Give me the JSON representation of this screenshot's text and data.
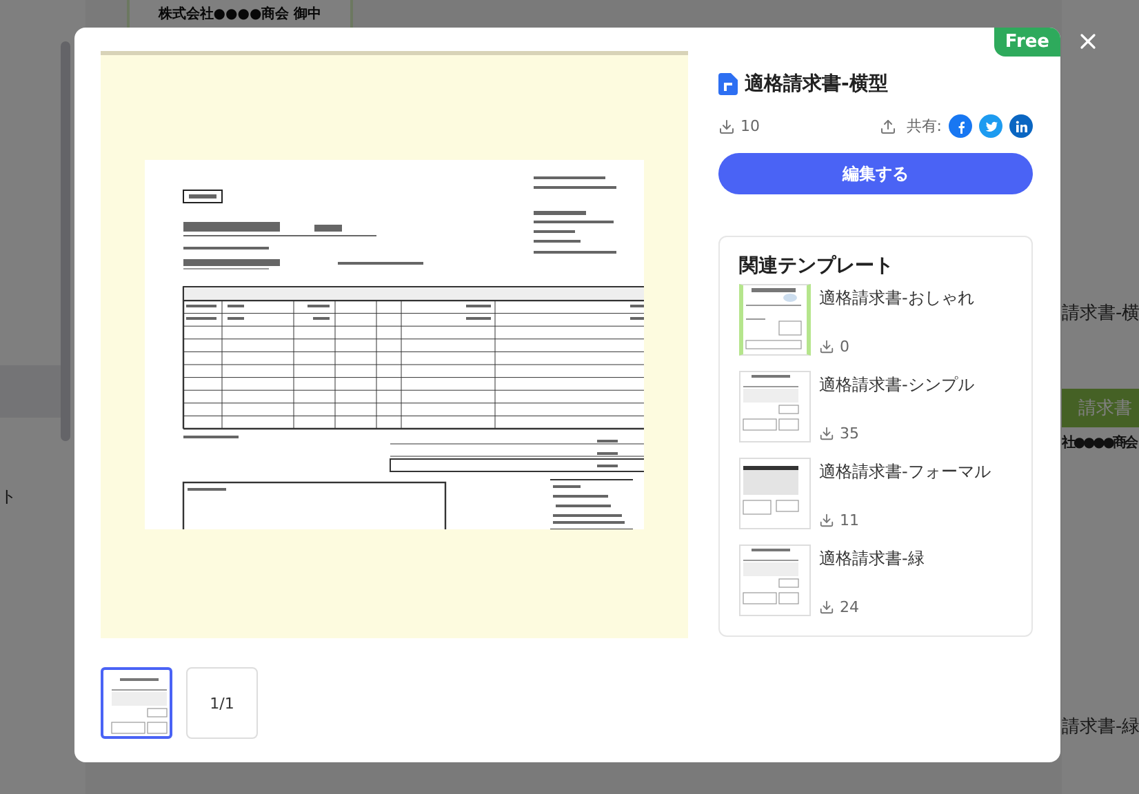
{
  "background": {
    "top_caption": "株式会社●●●●商会 御中",
    "left_fragment": "ト",
    "right_items": [
      {
        "kind": "title",
        "text": "請求書-横"
      },
      {
        "kind": "bar",
        "text": "請求書"
      },
      {
        "kind": "small",
        "text": "社●●●●商会"
      },
      {
        "kind": "title",
        "text": "請求書-緑"
      }
    ]
  },
  "badge": "Free",
  "template": {
    "title": "適格請求書-横型",
    "downloads": "10",
    "share_label": "共有:",
    "edit_button": "編集する"
  },
  "page_thumbnails": [
    {
      "selected": true
    }
  ],
  "page_count": "1/1",
  "related": {
    "heading": "関連テンプレート",
    "items": [
      {
        "title": "適格請求書-おしゃれ",
        "downloads": "0",
        "kind": "green"
      },
      {
        "title": "適格請求書-シンプル",
        "downloads": "35",
        "kind": "simple"
      },
      {
        "title": "適格請求書-フォーマル",
        "downloads": "11",
        "kind": "formal"
      },
      {
        "title": "適格請求書-緑",
        "downloads": "24",
        "kind": "simple"
      }
    ]
  }
}
